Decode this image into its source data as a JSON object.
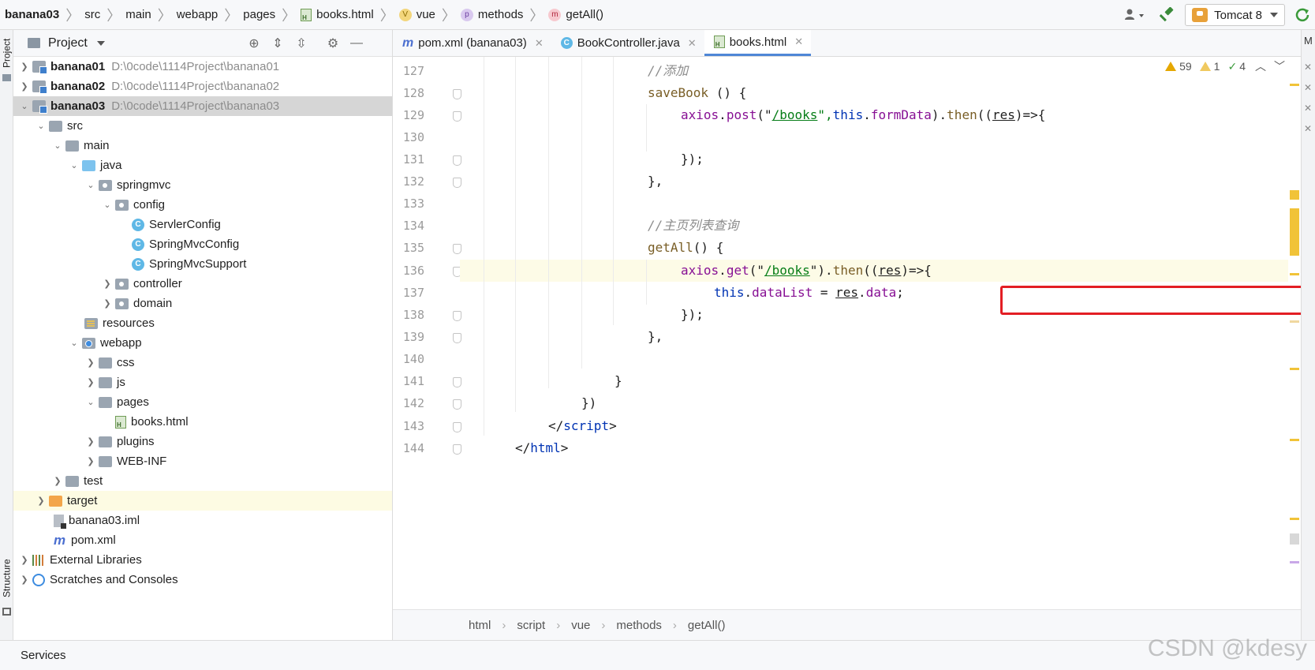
{
  "navbar": {
    "crumbs": [
      "banana03",
      "src",
      "main",
      "webapp",
      "pages",
      "books.html",
      "vue",
      "methods",
      "getAll()"
    ],
    "run_config": "Tomcat 8"
  },
  "left_strip": {
    "project_tab": "Project",
    "structure_tab": "Structure"
  },
  "right_strip": {
    "tab": "M"
  },
  "project_panel": {
    "title": "Project",
    "tree": [
      {
        "label": "banana01",
        "path": "D:\\0code\\1114Project\\banana01"
      },
      {
        "label": "banana02",
        "path": "D:\\0code\\1114Project\\banana02"
      },
      {
        "label": "banana03",
        "path": "D:\\0code\\1114Project\\banana03"
      },
      {
        "label": "src"
      },
      {
        "label": "main"
      },
      {
        "label": "java"
      },
      {
        "label": "springmvc"
      },
      {
        "label": "config"
      },
      {
        "label": "ServlerConfig"
      },
      {
        "label": "SpringMvcConfig"
      },
      {
        "label": "SpringMvcSupport"
      },
      {
        "label": "controller"
      },
      {
        "label": "domain"
      },
      {
        "label": "resources"
      },
      {
        "label": "webapp"
      },
      {
        "label": "css"
      },
      {
        "label": "js"
      },
      {
        "label": "pages"
      },
      {
        "label": "books.html"
      },
      {
        "label": "plugins"
      },
      {
        "label": "WEB-INF"
      },
      {
        "label": "test"
      },
      {
        "label": "target"
      },
      {
        "label": "banana03.iml"
      },
      {
        "label": "pom.xml"
      },
      {
        "label": "External Libraries"
      },
      {
        "label": "Scratches and Consoles"
      }
    ]
  },
  "editor": {
    "tabs": [
      "pom.xml (banana03)",
      "BookController.java",
      "books.html"
    ],
    "active_tab": "books.html",
    "inspections": {
      "warnings": "59",
      "weak_warnings": "1",
      "typos": "4"
    },
    "line_numbers": [
      "127",
      "128",
      "129",
      "130",
      "131",
      "132",
      "133",
      "134",
      "135",
      "136",
      "137",
      "138",
      "139",
      "140",
      "141",
      "142",
      "143",
      "144"
    ],
    "current_line": "136",
    "code": {
      "l127_comment": "//添加",
      "l128_fn": "saveBook",
      "l128_rest": " () {",
      "l129_obj": "axios",
      "l129_dot": ".",
      "l129_method": "post",
      "l129_p1": "(\"",
      "l129_str": "/books",
      "l129_p2": "\",",
      "l129_this": "this",
      "l129_dot2": ".",
      "l129_prop": "formData",
      "l129_p3": ").",
      "l129_then": "then",
      "l129_p4": "((",
      "l129_res": "res",
      "l129_p5": ")=>{",
      "l131": "});",
      "l132": "},",
      "l134_comment": "//主页列表查询",
      "l135_fn": "getAll",
      "l135_rest": "() {",
      "l136_obj": "axios",
      "l136_dot": ".",
      "l136_method": "get",
      "l136_p1": "(\"",
      "l136_str": "/books",
      "l136_p2": "\").",
      "l136_then": "then",
      "l136_p3": "((",
      "l136_res": "res",
      "l136_p4": ")=>{",
      "l137_this": "this",
      "l137_dot": ".",
      "l137_prop": "dataList",
      "l137_eq": " = ",
      "l137_res": "res",
      "l137_dot2": ".",
      "l137_data": "data",
      "l137_semi": ";",
      "l138": "});",
      "l139": "},",
      "l141": "}",
      "l142": "})",
      "l143_open": "</",
      "l143_tag": "script",
      "l143_close": ">",
      "l144_open": "</",
      "l144_tag": "html",
      "l144_close": ">"
    },
    "breadcrumb": [
      "html",
      "script",
      "vue",
      "methods",
      "getAll()"
    ]
  },
  "statusbar": {
    "services": "Services"
  },
  "watermark": "CSDN @kdesy",
  "colors": {
    "highlight_box": "#e31e24",
    "active_tab_underline": "#4f87d6"
  }
}
